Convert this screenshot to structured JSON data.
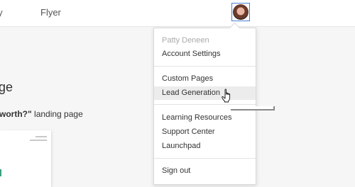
{
  "topnav": {
    "partial_item": "erty",
    "flyer": "Flyer"
  },
  "user": {
    "name": "Patty Deneen"
  },
  "page": {
    "title": "ge",
    "subtitle_bold": "worth?\"",
    "subtitle_rest": " landing page"
  },
  "menu": {
    "account_settings": "Account Settings",
    "custom_pages": "Custom Pages",
    "lead_generation": "Lead Generation",
    "learning_resources": "Learning Resources",
    "support_center": "Support Center",
    "launchpad": "Launchpad",
    "sign_out": "Sign out"
  },
  "colors": {
    "avatar_border": "#4a7fd4",
    "hover_bg": "#ececec",
    "accent": "#3aa17e"
  },
  "icons": {
    "cursor": "hand-pointer-icon"
  }
}
